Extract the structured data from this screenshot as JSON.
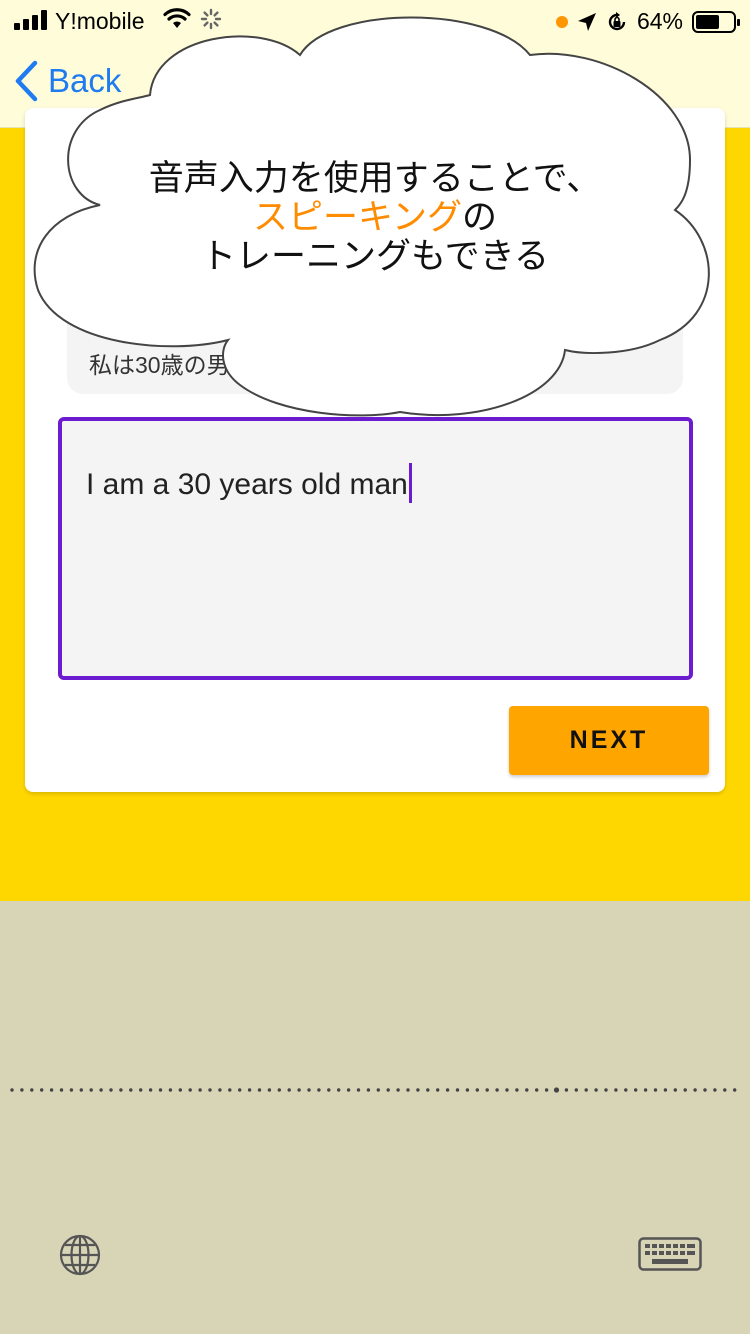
{
  "status_bar": {
    "carrier": "Y!mobile",
    "battery": "64%",
    "battery_level": 0.64
  },
  "nav": {
    "back_label": "Back"
  },
  "card": {
    "heading_fragment": "",
    "hint_text": "私は30歳の男",
    "answer_value": "I am a 30 years old man",
    "next_label": "NEXT"
  },
  "callout": {
    "line1": "音声入力を使用することで、",
    "line2_highlight": "スピーキング",
    "line2_rest": "の",
    "line3": "トレーニングもできる",
    "highlight_color": "#FF8C00"
  },
  "colors": {
    "background": "#FFD700",
    "topbar": "#FFFCD9",
    "accent": "#6B1BD0",
    "button": "#FFA500",
    "link": "#1E7BF0",
    "keyboard": "#D8D5B7"
  },
  "icons": [
    "signal-icon",
    "wifi-icon",
    "loading-icon",
    "location-icon",
    "orientation-lock-icon",
    "battery-icon",
    "chevron-left-icon",
    "globe-icon",
    "keyboard-icon"
  ]
}
